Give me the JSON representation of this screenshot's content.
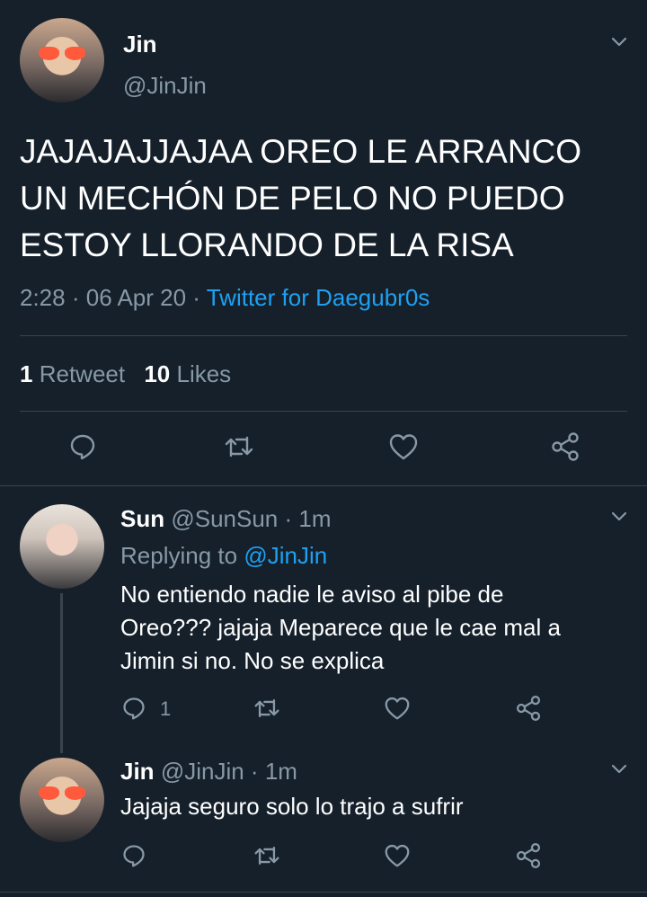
{
  "main_tweet": {
    "author_name": "Jin",
    "author_handle": "@JinJin",
    "text_lines": [
      "JAJAJAJJAJAA OREO LE ARRANCO",
      "UN MECHÓN DE PELO NO PUEDO",
      "ESTOY LLORANDO DE LA RISA"
    ],
    "time": "2:28",
    "sep1": "·",
    "date": "06 Apr 20",
    "sep2": "·",
    "source": "Twitter for Daegubr0s",
    "retweet_count": "1",
    "retweet_label": "Retweet",
    "like_count": "10",
    "like_label": "Likes"
  },
  "replies": [
    {
      "author_name": "Sun",
      "author_handle": "@SunSun",
      "sep": "·",
      "time": "1m",
      "replying_to_label": "Replying to",
      "replying_to_handle": "@JinJin",
      "text_lines": [
        "No entiendo nadie le aviso al pibe de",
        "Oreo??? jajaja Meparece que le cae mal a",
        "Jimin si no. No se explica"
      ],
      "reply_count": "1"
    },
    {
      "author_name": "Jin",
      "author_handle": "@JinJin",
      "sep": "·",
      "time": "1m",
      "text_lines": [
        "Jajaja seguro solo lo trajo a sufrir"
      ]
    }
  ],
  "colors": {
    "background": "#15202b",
    "text": "#ffffff",
    "muted": "#8899a6",
    "link": "#1da1f2",
    "divider": "#38444d"
  },
  "icons": [
    "chevron-down-icon",
    "reply-icon",
    "retweet-icon",
    "like-icon",
    "share-icon"
  ]
}
